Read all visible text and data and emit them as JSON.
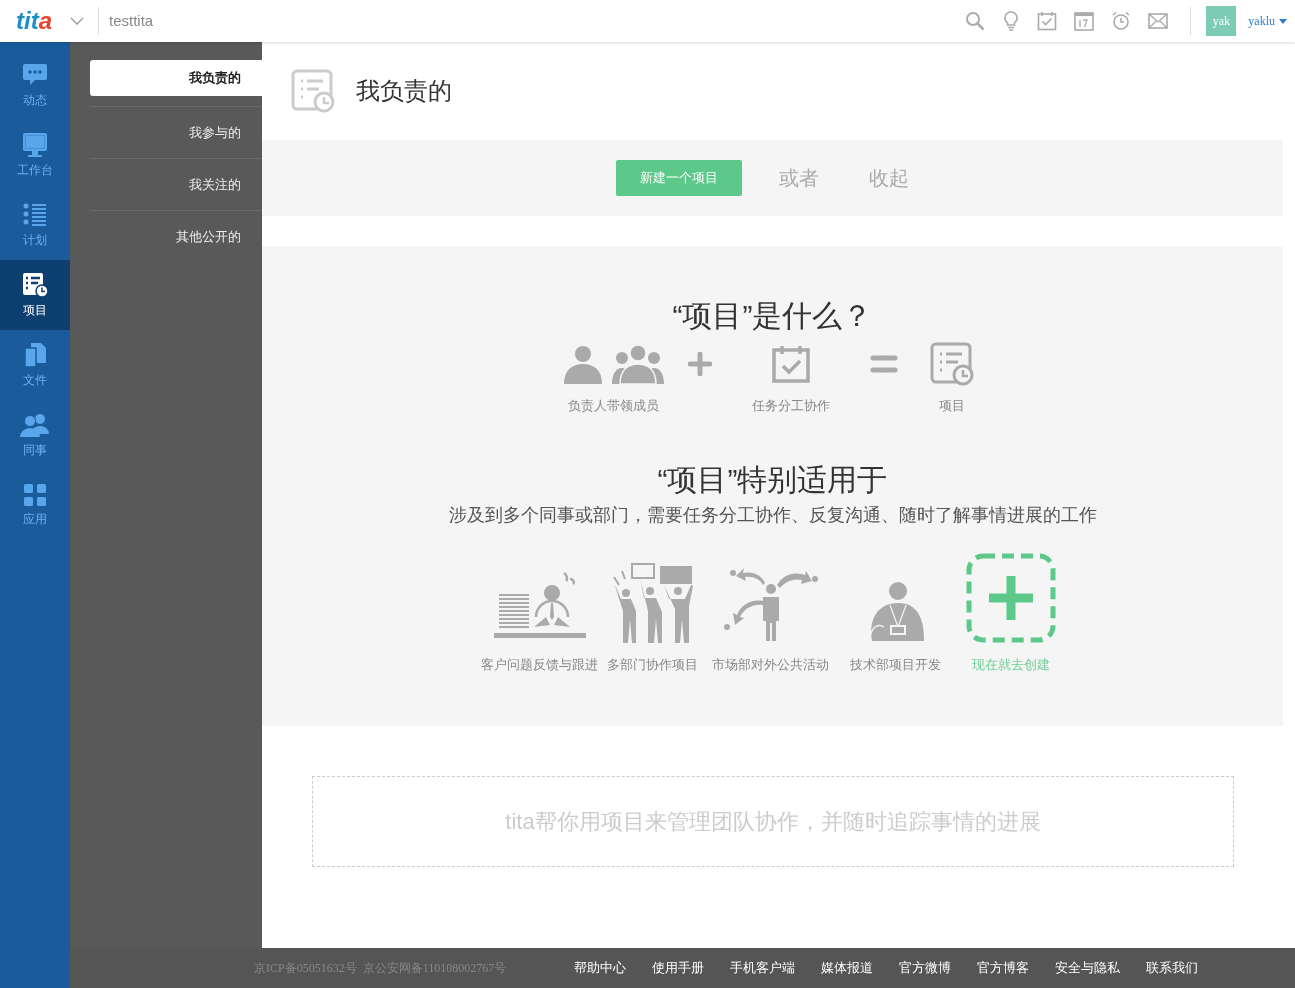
{
  "topbar": {
    "logo": "tita",
    "company": "testtita",
    "avatar": "yak",
    "username": "yaklu"
  },
  "nav": [
    {
      "label": "动态",
      "selected": false
    },
    {
      "label": "工作台",
      "selected": false
    },
    {
      "label": "计划",
      "selected": false
    },
    {
      "label": "项目",
      "selected": true
    },
    {
      "label": "文件",
      "selected": false
    },
    {
      "label": "同事",
      "selected": false
    },
    {
      "label": "应用",
      "selected": false
    }
  ],
  "subnav": [
    {
      "label": "我负责的",
      "selected": true
    },
    {
      "label": "我参与的",
      "selected": false
    },
    {
      "label": "我关注的",
      "selected": false
    },
    {
      "label": "其他公开的",
      "selected": false
    }
  ],
  "page_title": "我负责的",
  "actions": {
    "primary": "新建一个项目",
    "or": "或者",
    "collapse": "收起"
  },
  "what_is": {
    "title": "“项目”是什么？",
    "terms": [
      "负责人带领成员",
      "任务分工协作",
      "项目"
    ]
  },
  "suited": {
    "title": "“项目”特别适用于",
    "description": "涉及到多个同事或部门，需要任务分工协作、反复沟通、随时了解事情进展的工作",
    "cases": [
      {
        "label": "客户问题反馈与跟进",
        "kind": "example"
      },
      {
        "label": "多部门协作项目",
        "kind": "example"
      },
      {
        "label": "市场部对外公共活动",
        "kind": "example"
      },
      {
        "label": "技术部项目开发",
        "kind": "example"
      },
      {
        "label": "现在就去创建",
        "kind": "create"
      }
    ]
  },
  "banner": "tita帮你用项目来管理团队协作，并随时追踪事情的进展",
  "footer": {
    "records": [
      "京ICP备05051632号",
      "京公安网备110108002767号"
    ],
    "links": [
      "帮助中心",
      "使用手册",
      "手机客户端",
      "媒体报道",
      "官方微博",
      "官方博客",
      "安全与隐私",
      "联系我们"
    ]
  }
}
